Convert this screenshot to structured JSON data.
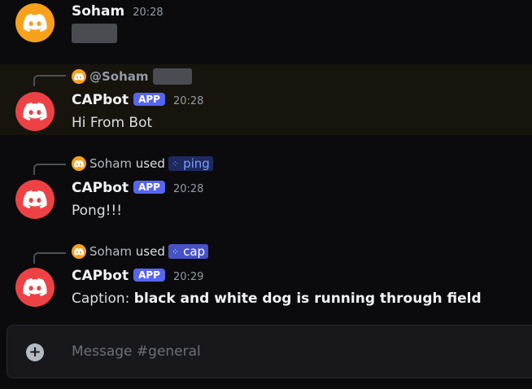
{
  "colors": {
    "user_avatar": "#f7a11b",
    "bot_avatar": "#ed4245",
    "app_badge": "#5865f2",
    "highlight_row": "#17140e"
  },
  "messages": [
    {
      "author": "Soham",
      "time": "20:28"
    },
    {
      "reply_mention": "@Soham",
      "author": "CAPbot",
      "badge": "APP",
      "time": "20:28",
      "text": "Hi From Bot"
    },
    {
      "reply_user": "Soham",
      "reply_used": "used",
      "command": "ping",
      "author": "CAPbot",
      "badge": "APP",
      "time": "20:28",
      "text": "Pong!!!"
    },
    {
      "reply_user": "Soham",
      "reply_used": "used",
      "command": "cap",
      "author": "CAPbot",
      "badge": "APP",
      "time": "20:29",
      "text_prefix": "Caption: ",
      "text_bold": "black and white dog is running through field"
    }
  ],
  "composer": {
    "placeholder": "Message #general",
    "add_icon": "plus-circle-icon"
  }
}
